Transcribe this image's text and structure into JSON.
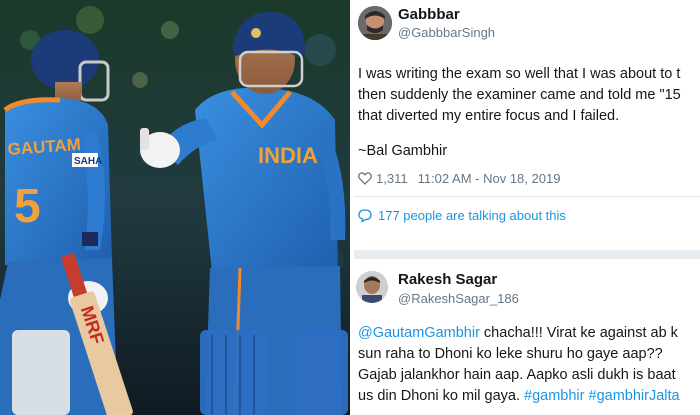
{
  "photo": {
    "jersey_left_name": "GAUTAM",
    "jersey_left_number": "5",
    "jersey_right_text": "INDIA",
    "bat_brand": "MRF",
    "sleeve_badge": "SAHA"
  },
  "tweet1": {
    "name": "Gabbbar",
    "handle": "@GabbbarSingh",
    "lines": [
      "I was writing the exam so well that I was about to t",
      "then suddenly the examiner came and told me \"15",
      "that diverted my entire focus and I failed."
    ],
    "signature": "~Bal Gambhir",
    "likes": "1,311",
    "timestamp": "11:02 AM - Nov 18, 2019",
    "talking": "177 people are talking about this"
  },
  "tweet2": {
    "name": "Rakesh Sagar",
    "handle": "@RakeshSagar_186",
    "mention": "@GautamGambhir",
    "line1_rest": " chacha!!! Virat ke against ab k",
    "line2": "sun raha to Dhoni ko leke shuru ho gaye aap??",
    "line3": "Gajab jalankhor hain aap. Aapko asli dukh is baat",
    "line4_text": "us din Dhoni ko mil gaya. ",
    "hashtag1": "#gambhir",
    "hashtag2": "#gambhirJalta"
  },
  "colors": {
    "link": "#1b95e0",
    "secondary_text": "#657786",
    "divider": "#e6ecf0",
    "jersey_blue": "#2f7fd0"
  }
}
